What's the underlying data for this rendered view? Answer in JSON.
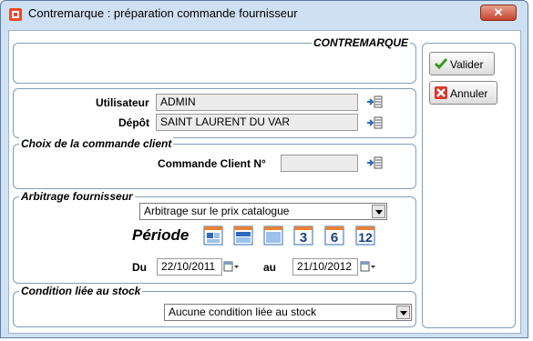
{
  "window": {
    "title": "Contremarque : préparation commande fournisseur",
    "close_label": "✕"
  },
  "contremarque": {
    "legend": "CONTREMARQUE"
  },
  "user": {
    "utilisateur_label": "Utilisateur",
    "utilisateur_value": "ADMIN",
    "depot_label": "Dépôt",
    "depot_value": "SAINT LAURENT DU VAR"
  },
  "commande_client": {
    "legend": "Choix de la commande client",
    "label": "Commande Client N°",
    "value": ""
  },
  "arbitrage": {
    "legend": "Arbitrage fournisseur",
    "selected": "Arbitrage sur le prix catalogue",
    "periode_label": "Période",
    "period_buttons": [
      "",
      "",
      "",
      "3",
      "6",
      "12"
    ],
    "du_label": "Du",
    "du_value": "22/10/2011",
    "au_label": "au",
    "au_value": "21/10/2012"
  },
  "stock": {
    "legend": "Condition liée au stock",
    "selected": "Aucune condition liée au stock"
  },
  "actions": {
    "valider": "Valider",
    "annuler": "Annuler"
  },
  "colors": {
    "accent": "#cfe0f3",
    "close": "#c7432b",
    "calendar": "#2e6bb8"
  },
  "icons": [
    "window-app-icon",
    "close-icon",
    "lookup-icon",
    "calendar-icon",
    "check-icon",
    "cancel-icon"
  ]
}
